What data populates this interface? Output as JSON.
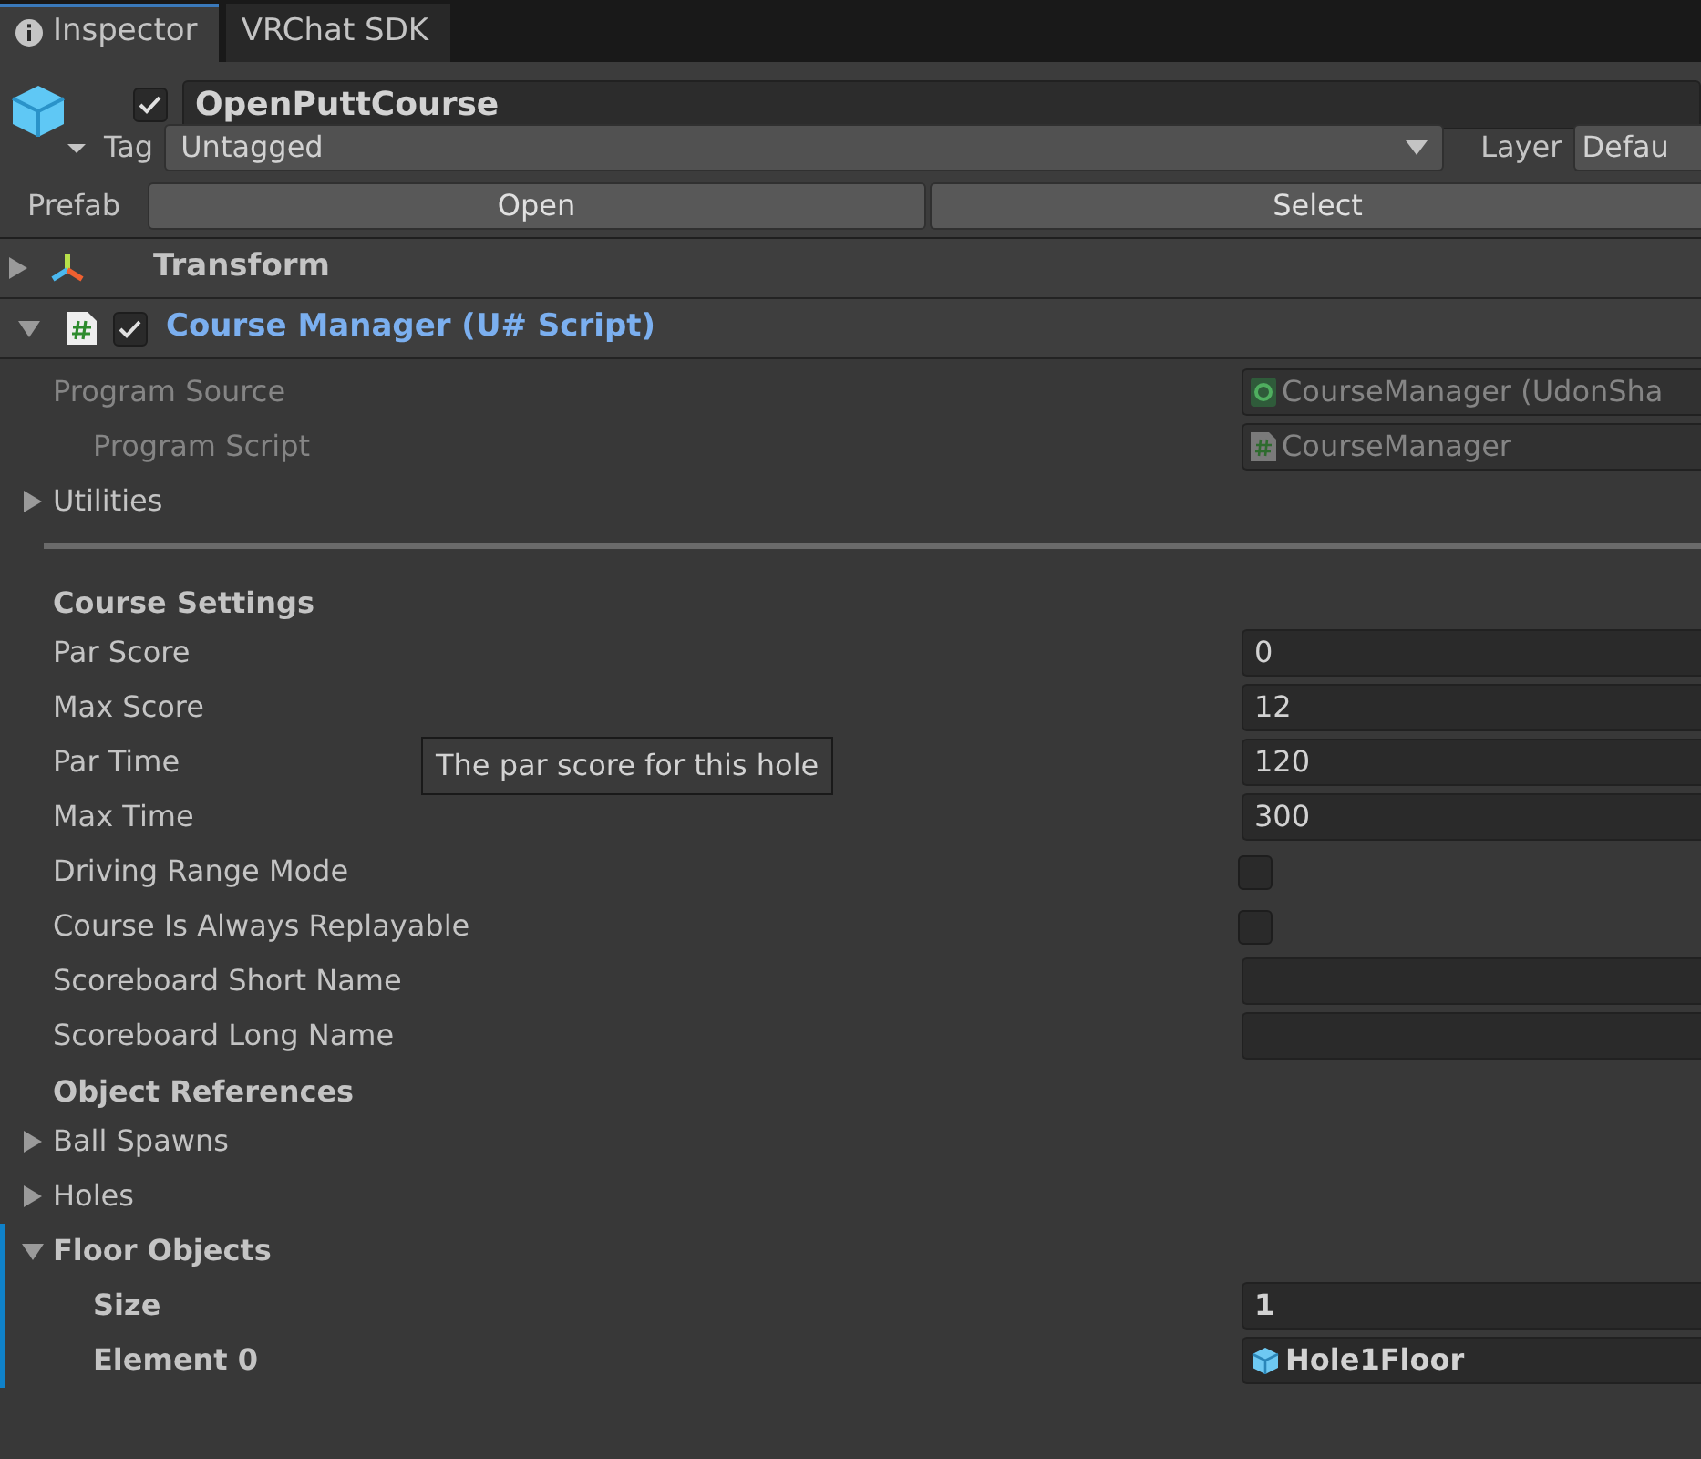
{
  "tabs": [
    {
      "label": "Inspector",
      "selected": true
    },
    {
      "label": "VRChat SDK",
      "selected": false
    }
  ],
  "object": {
    "active": true,
    "name": "OpenPuttCourse",
    "tag_label": "Tag",
    "tag": "Untagged",
    "layer_label": "Layer",
    "layer": "Defau",
    "prefab_label": "Prefab",
    "prefab_buttons": [
      "Open",
      "Select"
    ]
  },
  "components": [
    {
      "kind": "transform",
      "title": "Transform",
      "expanded": false
    },
    {
      "kind": "script",
      "title": "Course Manager (U# Script)",
      "expanded": true,
      "enabled": true
    }
  ],
  "properties": [
    {
      "kind": "programref",
      "label": "Program Source",
      "value": "CourseManager (UdonSha",
      "disabled": true,
      "children": [
        {
          "kind": "scriptref",
          "label": "Program Script",
          "value": "CourseManager",
          "disabled": true
        }
      ]
    },
    {
      "kind": "foldout",
      "label": "Utilities",
      "expanded": false,
      "overridden": false
    },
    {
      "kind": "separator"
    },
    {
      "kind": "header",
      "label": "Course Settings"
    },
    {
      "kind": "text",
      "label": "Par Score",
      "value": "0"
    },
    {
      "kind": "text",
      "label": "Max Score",
      "value": "12"
    },
    {
      "kind": "text",
      "label": "Par Time",
      "value": "120"
    },
    {
      "kind": "text",
      "label": "Max Time",
      "value": "300"
    },
    {
      "kind": "checkbox",
      "label": "Driving Range Mode",
      "checked": false
    },
    {
      "kind": "checkbox",
      "label": "Course Is Always Replayable",
      "checked": false
    },
    {
      "kind": "text",
      "label": "Scoreboard Short Name"
    },
    {
      "kind": "text",
      "label": "Scoreboard Long Name"
    },
    {
      "kind": "header",
      "label": "Object References"
    },
    {
      "kind": "foldout",
      "label": "Ball Spawns",
      "expanded": false,
      "overridden": false
    },
    {
      "kind": "foldout",
      "label": "Holes",
      "expanded": false,
      "overridden": false
    },
    {
      "kind": "foldout",
      "label": "Floor Objects",
      "expanded": true,
      "overridden": true,
      "children": [
        {
          "kind": "text",
          "label": "Size",
          "value": "1"
        },
        {
          "kind": "objectref",
          "label": "Element 0",
          "value": "Hole1Floor",
          "disabled": false
        }
      ]
    }
  ],
  "tooltip": {
    "text": "The par score for this hole"
  }
}
